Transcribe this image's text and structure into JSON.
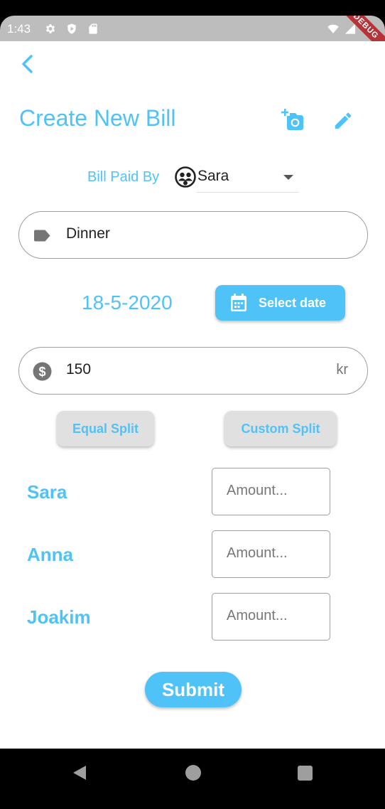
{
  "status_bar": {
    "time": "1:43",
    "debug_banner": "DEBUG"
  },
  "header": {
    "title": "Create New Bill"
  },
  "paid_by": {
    "label": "Bill Paid By",
    "selected": "Sara"
  },
  "bill_name": {
    "value": "Dinner"
  },
  "date": {
    "value": "18-5-2020",
    "button_label": "Select date"
  },
  "amount": {
    "value": "150",
    "currency": "kr"
  },
  "split": {
    "equal_label": "Equal Split",
    "custom_label": "Custom Split"
  },
  "participants": [
    {
      "name": "Sara",
      "amount_placeholder": "Amount..."
    },
    {
      "name": "Anna",
      "amount_placeholder": "Amount..."
    },
    {
      "name": "Joakim",
      "amount_placeholder": "Amount..."
    }
  ],
  "submit_label": "Submit",
  "colors": {
    "accent": "#4fc3f7",
    "status_bar": "#bdbdbd",
    "debug": "#b5343a",
    "split_button_bg": "#e0e0e0"
  },
  "icons": {
    "back": "arrow-back-icon",
    "camera": "add-a-photo-icon",
    "edit": "edit-pencil-icon",
    "avatar": "group-avatar-icon",
    "label": "label-tag-icon",
    "calendar": "calendar-icon",
    "currency": "dollar-circle-icon"
  }
}
